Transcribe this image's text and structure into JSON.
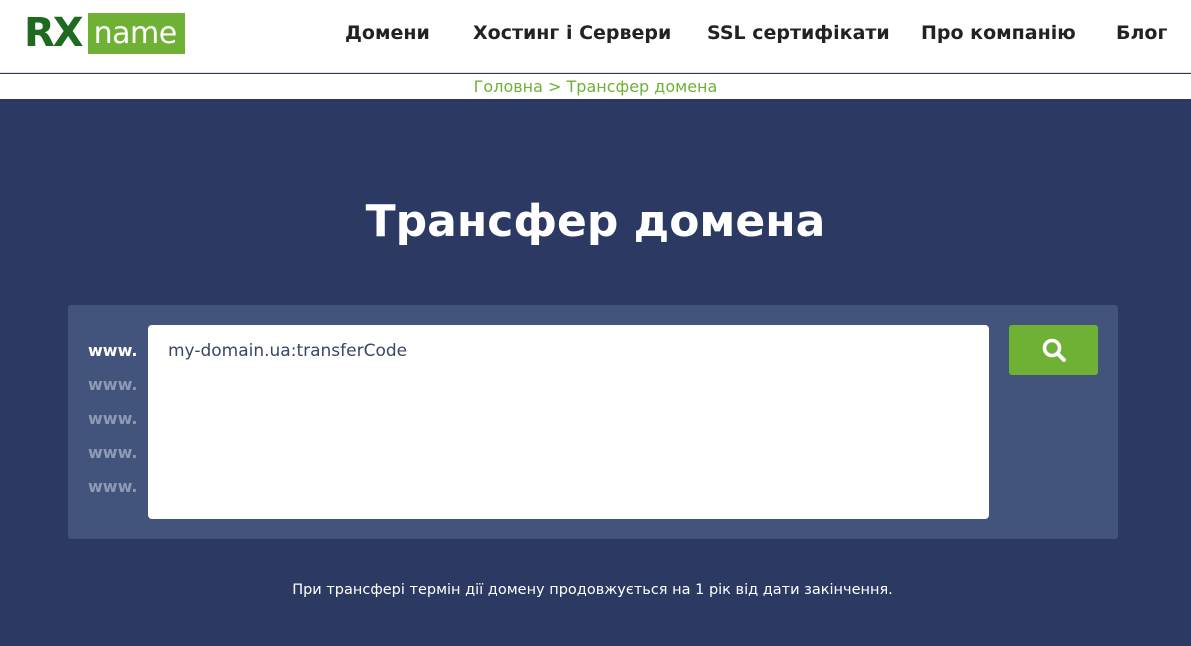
{
  "brand": {
    "logo_rx": "RX",
    "logo_name": "name",
    "accent": "#6eb135",
    "dark_green": "#1e6a1e"
  },
  "nav": {
    "items": [
      {
        "label": "Домени"
      },
      {
        "label": "Хостинг і Сервери"
      },
      {
        "label": "SSL сертифікати"
      },
      {
        "label": "Про компанію"
      },
      {
        "label": "Блог"
      }
    ]
  },
  "breadcrumb": {
    "home": "Головна",
    "separator": " > ",
    "current": "Трансфер домена"
  },
  "page": {
    "title": "Трансфер домена",
    "background": "#2c3a63"
  },
  "search": {
    "prefixes": [
      "www.",
      "www.",
      "www.",
      "www.",
      "www."
    ],
    "placeholder": "my-domain.ua:transferCode",
    "button_icon": "search-icon"
  },
  "note": "При трансфері термін дії домену продовжується на 1 рік від дати закінчення."
}
